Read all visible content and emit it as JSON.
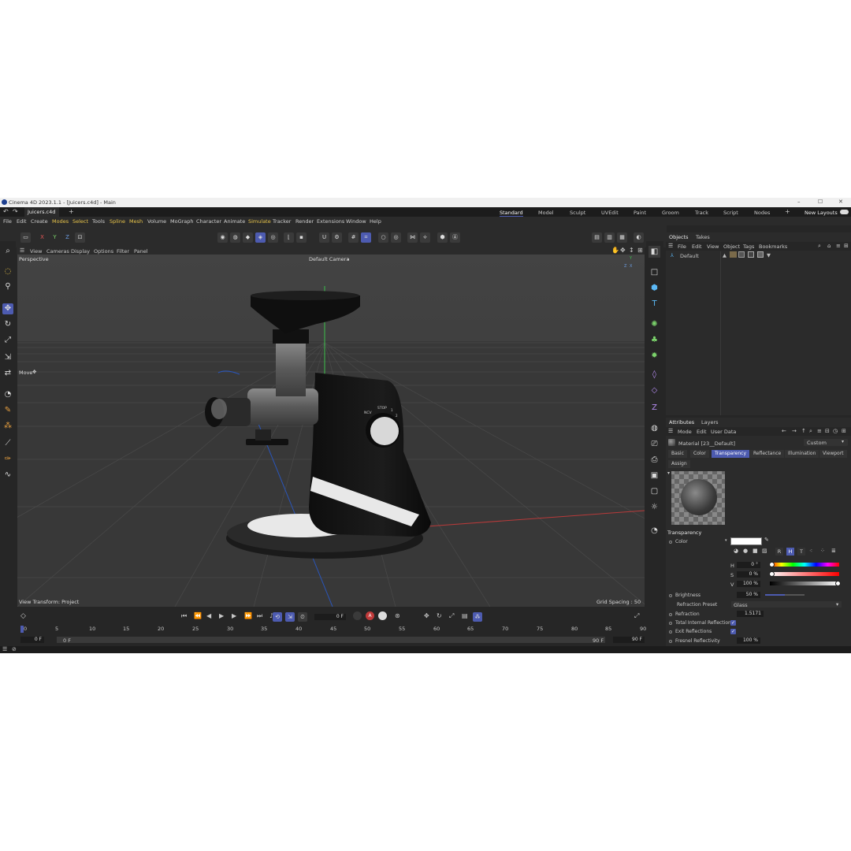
{
  "window": {
    "title": "Cinema 4D 2023.1.1 - [Juicers.c4d] - Main",
    "minimize": "–",
    "maximize": "☐",
    "close": "✕"
  },
  "doc_tab": {
    "name": "Juicers.c4d",
    "add": "+"
  },
  "layouts": {
    "items": [
      "Standard",
      "Model",
      "Sculpt",
      "UVEdit",
      "Paint",
      "Groom",
      "Track",
      "Script",
      "Nodes"
    ],
    "add": "+",
    "new_layouts": "New Layouts"
  },
  "menu": [
    "File",
    "Edit",
    "Create",
    "Modes",
    "Select",
    "Tools",
    "Spline",
    "Mesh",
    "Volume",
    "MoGraph",
    "Character",
    "Animate",
    "Simulate",
    "Tracker",
    "Render",
    "Extensions",
    "Window",
    "Help"
  ],
  "axis_toggles": {
    "x": "X",
    "y": "Y",
    "z": "Z"
  },
  "viewport": {
    "menu": [
      "View",
      "Cameras",
      "Display",
      "Options",
      "Filter",
      "Panel"
    ],
    "projection": "Perspective",
    "camera": "Default Camera",
    "camera_suffix": "∘",
    "tool_label": "Move",
    "tool_icon": "✥",
    "view_transform": "View Transform: Project",
    "grid_spacing": "Grid Spacing : 50 cm",
    "knob_label_1": "NCV",
    "knob_label_2": "STOP",
    "knob_label_3": "1",
    "knob_label_4": "2",
    "gizmo_y": "Y",
    "gizmo_x": "X",
    "gizmo_z": "Z"
  },
  "timeline": {
    "ticks": [
      "0",
      "5",
      "10",
      "15",
      "20",
      "25",
      "30",
      "35",
      "40",
      "45",
      "50",
      "55",
      "60",
      "65",
      "70",
      "75",
      "80",
      "85",
      "90"
    ],
    "current_frame": "0 F",
    "start": "0 F",
    "start2": "0 F",
    "end": "90 F",
    "end2": "90 F"
  },
  "objects_panel": {
    "tabs": [
      "Objects",
      "Takes"
    ],
    "menu": [
      "File",
      "Edit",
      "View",
      "Object",
      "Tags",
      "Bookmarks"
    ],
    "item": "Default"
  },
  "attributes_panel": {
    "tabs": [
      "Attributes",
      "Layers"
    ],
    "menu": [
      "Mode",
      "Edit",
      "User Data"
    ],
    "material_name": "Material [23__Default]",
    "preset": "Custom",
    "subtabs": [
      "Basic",
      "Color",
      "Transparency",
      "Reflectance",
      "Illumination",
      "Viewport"
    ],
    "active_subtab": "Transparency",
    "assign": "Assign",
    "section": "Transparency",
    "color_label": "Color",
    "hsv_buttons": [
      "R",
      "H",
      "T"
    ],
    "h_label": "H",
    "h_value": "0 °",
    "s_label": "S",
    "s_value": "0 %",
    "v_label": "V",
    "v_value": "100 %",
    "brightness_label": "Brightness",
    "brightness_value": "50 %",
    "brightness_level": 0.5,
    "refraction_preset_label": "Refraction Preset",
    "refraction_preset_value": "Glass",
    "refraction_label": "Refraction",
    "refraction_value": "1.5171",
    "tir_label": "Total Internal Reflection",
    "exit_label": "Exit Reflections",
    "fresnel_label": "Fresnel Reflectivity",
    "fresnel_value": "100 %"
  },
  "colors": {
    "accent": "#4d5bb0",
    "bg": "#262626",
    "panel": "#2b2b2b"
  }
}
